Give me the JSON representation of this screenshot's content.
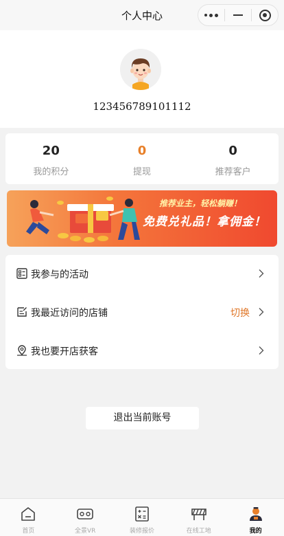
{
  "header": {
    "title": "个人中心"
  },
  "profile": {
    "username": "123456789101112"
  },
  "stats": [
    {
      "value": "20",
      "label": "我的积分"
    },
    {
      "value": "0",
      "label": "提现"
    },
    {
      "value": "0",
      "label": "推荐客户"
    }
  ],
  "banner": {
    "line1": "推荐业主，轻松躺赚！",
    "line2": "免费兑礼品！拿佣金！"
  },
  "menu": [
    {
      "label": "我参与的活动",
      "action": "",
      "icon": "activity-list-icon"
    },
    {
      "label": "我最近访问的店铺",
      "action": "切换",
      "icon": "recent-store-icon"
    },
    {
      "label": "我也要开店获客",
      "action": "",
      "icon": "location-pin-icon"
    }
  ],
  "logout": {
    "label": "退出当前账号"
  },
  "tabbar": [
    {
      "label": "首页",
      "icon": "home-icon",
      "active": false
    },
    {
      "label": "全景VR",
      "icon": "vr-glasses-icon",
      "active": false
    },
    {
      "label": "装修报价",
      "icon": "calculator-icon",
      "active": false
    },
    {
      "label": "在线工地",
      "icon": "construction-site-icon",
      "active": false
    },
    {
      "label": "我的",
      "icon": "user-icon",
      "active": true
    }
  ],
  "colors": {
    "accent": "#e8802a",
    "banner_start": "#f6a25a",
    "banner_end": "#f0492f",
    "background": "#f2f2f2"
  }
}
